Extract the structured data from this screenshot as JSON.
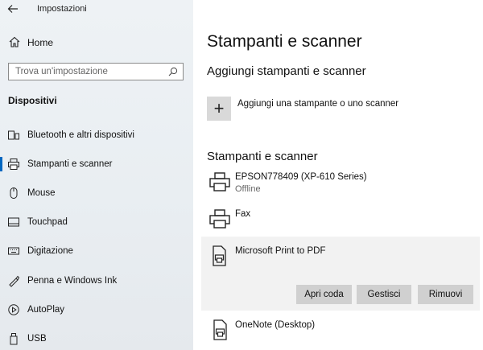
{
  "window": {
    "title": "Impostazioni"
  },
  "sidebar": {
    "home_label": "Home",
    "search_placeholder": "Trova un'impostazione",
    "section_label": "Dispositivi",
    "items": [
      {
        "label": "Bluetooth e altri dispositivi",
        "icon": "bluetooth-device-icon"
      },
      {
        "label": "Stampanti e scanner",
        "icon": "printer-icon",
        "selected": true
      },
      {
        "label": "Mouse",
        "icon": "mouse-icon"
      },
      {
        "label": "Touchpad",
        "icon": "touchpad-icon"
      },
      {
        "label": "Digitazione",
        "icon": "keyboard-icon"
      },
      {
        "label": "Penna e Windows Ink",
        "icon": "pen-icon"
      },
      {
        "label": "AutoPlay",
        "icon": "autoplay-icon"
      },
      {
        "label": "USB",
        "icon": "usb-icon"
      }
    ]
  },
  "main": {
    "title": "Stampanti e scanner",
    "add_section_title": "Aggiungi stampanti e scanner",
    "add_button_label": "Aggiungi una stampante o uno scanner",
    "list_section_title": "Stampanti e scanner",
    "printers": [
      {
        "name": "EPSON778409 (XP-610 Series)",
        "status": "Offline"
      },
      {
        "name": "Fax",
        "status": ""
      },
      {
        "name": "Microsoft Print to PDF",
        "status": "",
        "selected": true
      },
      {
        "name": "OneNote (Desktop)",
        "status": ""
      }
    ],
    "actions": {
      "open_queue": "Apri coda",
      "manage": "Gestisci",
      "remove": "Rimuovi"
    }
  },
  "colors": {
    "accent": "#0067c0",
    "sidebar_bg": "#ebeff2",
    "selected_row_bg": "#f2f2f2",
    "button_bg": "#d0d0d0"
  }
}
